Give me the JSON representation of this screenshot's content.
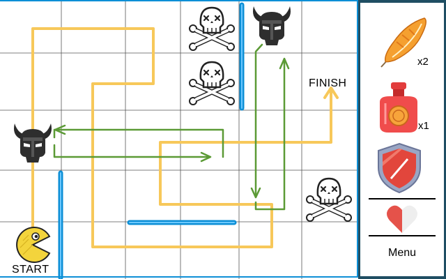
{
  "board": {
    "start_label": "START",
    "finish_label": "FINISH",
    "walls_color": "#0d8fd6",
    "player_path_color": "#f7c85a",
    "enemy_path_color": "#5b9a35",
    "entities": [
      {
        "kind": "player",
        "icon": "pacman-icon"
      },
      {
        "kind": "viking-enemy",
        "icon": "viking-helmet-icon"
      },
      {
        "kind": "viking-enemy",
        "icon": "viking-helmet-icon"
      },
      {
        "kind": "skull-hazard",
        "icon": "skull-crossbones-icon"
      },
      {
        "kind": "skull-hazard",
        "icon": "skull-crossbones-icon"
      },
      {
        "kind": "skull-hazard",
        "icon": "skull-crossbones-icon"
      }
    ]
  },
  "inventory": {
    "feather": {
      "icon": "feather-icon",
      "count": "x2"
    },
    "potion": {
      "icon": "potion-icon",
      "count": "x1"
    },
    "shield": {
      "icon": "shield-icon"
    },
    "health": {
      "icon": "heart-icon",
      "level": 0.5
    }
  },
  "menu": {
    "label": "Menu"
  }
}
